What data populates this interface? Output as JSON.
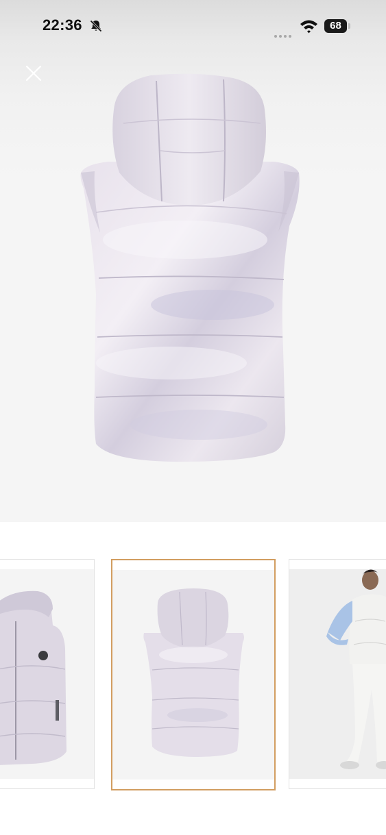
{
  "status_bar": {
    "time": "22:36",
    "battery": "68",
    "icons": [
      "bell-slash-icon",
      "signal-dots-icon",
      "wifi-icon",
      "battery-icon"
    ]
  },
  "header": {
    "close_icon": "close-icon"
  },
  "gallery": {
    "main_image": "hooded-puffer-vest-back-view",
    "thumbnails": [
      {
        "image": "hooded-puffer-vest-front-view",
        "selected": false
      },
      {
        "image": "hooded-puffer-vest-back-view",
        "selected": true
      },
      {
        "image": "model-wearing-white-vest",
        "selected": false
      }
    ]
  },
  "colors": {
    "vest": "#ded8e3",
    "vest_highlight": "#f2eef4",
    "vest_shadow": "#c3bdd0",
    "selected_border": "#d29d60"
  }
}
